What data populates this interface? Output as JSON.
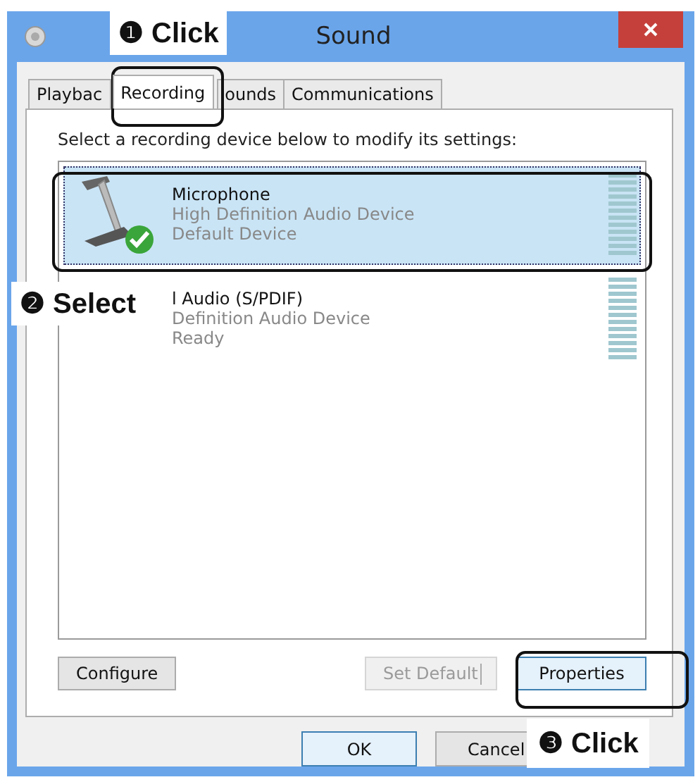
{
  "window": {
    "title": "Sound"
  },
  "tabs": [
    {
      "label": "Playbac",
      "selected": false
    },
    {
      "label": "Recording",
      "selected": true
    },
    {
      "label": "ounds",
      "selected": false
    },
    {
      "label": "Communications",
      "selected": false
    }
  ],
  "instruction": "Select a recording device below to modify its settings:",
  "devices": [
    {
      "name": "Microphone",
      "description": "High Definition Audio Device",
      "status": "Default Device",
      "selected": true,
      "default": true
    },
    {
      "name": "l Audio (S/PDIF)",
      "description": "Definition Audio Device",
      "status": "Ready",
      "selected": false
    }
  ],
  "buttons": [
    {
      "label": "Configure",
      "disabled": false
    },
    {
      "label": "Set Default",
      "disabled": true
    },
    {
      "label": "Properties",
      "disabled": false
    }
  ],
  "dialog_buttons": [
    {
      "label": "OK",
      "focused": true
    },
    {
      "label": "Cancel",
      "focused": false
    }
  ],
  "callouts": [
    "❶ Click",
    "❷ Select",
    "❸ Click"
  ]
}
